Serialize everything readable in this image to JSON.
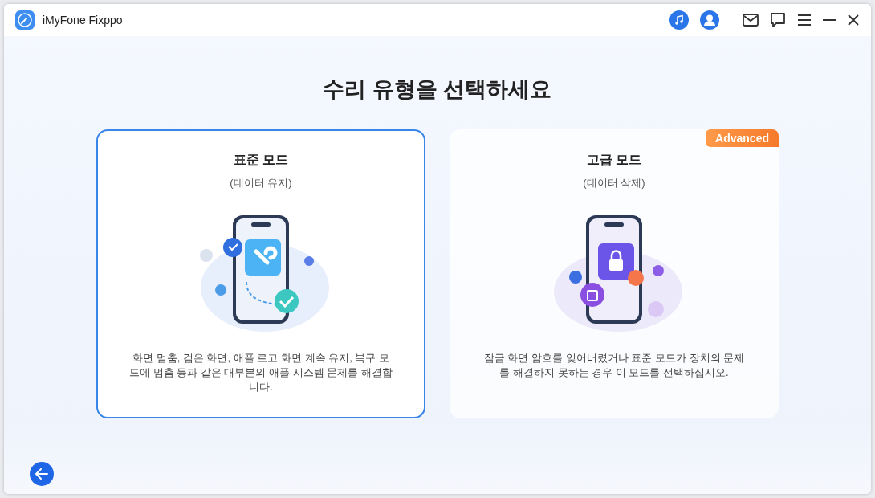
{
  "window": {
    "title": "iMyFone Fixppo"
  },
  "heading": "수리 유형을 선택하세요",
  "modes": [
    {
      "kind": "repair",
      "title": "표준 모드",
      "subtitle": "(데이터 유지)",
      "description": "화면 멈춤, 검은 화면, 애플 로고 화면 계속 유지, 복구 모드에 멈춤 등과 같은 대부분의 애플 시스템 문제를 해결합니다.",
      "selected": true
    },
    {
      "kind": "lock",
      "title": "고급 모드",
      "subtitle": "(데이터 삭제)",
      "description": "잠금 화면 암호를 잊어버렸거나 표준 모드가 장치의 문제를 해결하지 못하는 경우 이 모드를 선택하십시오.",
      "selected": false,
      "badge": "Advanced"
    }
  ]
}
